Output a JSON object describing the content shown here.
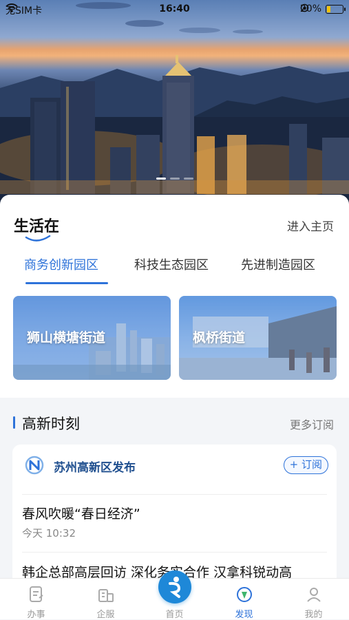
{
  "status_bar": {
    "carrier": "无SIM卡",
    "time": "16:40",
    "battery_percent": "20%",
    "battery_level": 0.2
  },
  "banner": {
    "page_dots": 3,
    "active_dot": 0
  },
  "life": {
    "title": "生活在",
    "enter_label": "进入主页",
    "tabs": [
      {
        "label": "商务创新园区",
        "active": true
      },
      {
        "label": "科技生态园区",
        "active": false
      },
      {
        "label": "先进制造园区",
        "active": false
      }
    ],
    "streets": [
      {
        "label": "狮山横塘街道"
      },
      {
        "label": "枫桥街道"
      }
    ]
  },
  "news_section": {
    "title": "高新时刻",
    "more_label": "更多订阅",
    "publisher": "苏州高新区发布",
    "subscribe_label": "+ 订阅",
    "articles": [
      {
        "title": "春风吹暖“春日经济”",
        "time": "今天 10:32"
      },
      {
        "title": "韩企总部高层回访 深化务实合作 汉拿科锐动高"
      }
    ]
  },
  "bottom_nav": [
    {
      "label": "办事",
      "icon": "document-icon"
    },
    {
      "label": "企服",
      "icon": "building-icon"
    },
    {
      "label": "首页",
      "icon": "home-logo-icon"
    },
    {
      "label": "发现",
      "icon": "compass-icon",
      "active": true
    },
    {
      "label": "我的",
      "icon": "user-icon"
    }
  ],
  "colors": {
    "accent": "#2d72d9",
    "home_button": "#1e88d8"
  }
}
